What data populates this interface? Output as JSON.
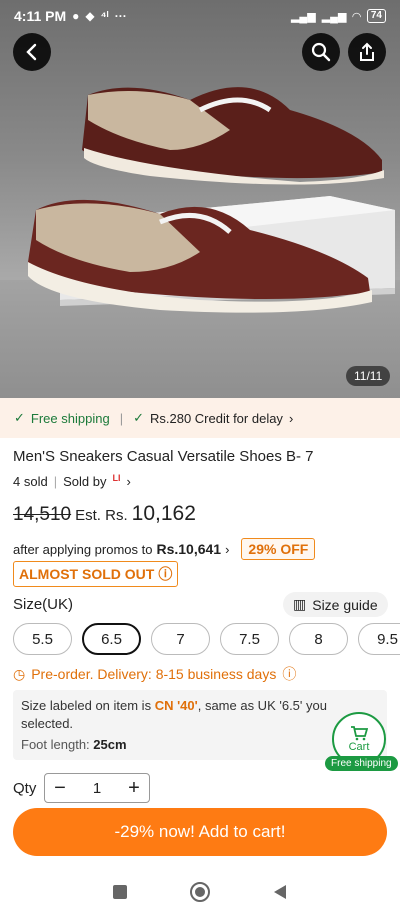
{
  "status_bar": {
    "time": "4:11 PM",
    "battery": "74"
  },
  "hero": {
    "counter": "11/11"
  },
  "shipping": {
    "free_shipping": "Free shipping",
    "credit": "Rs.280 Credit for delay"
  },
  "product": {
    "title": "Men'S Sneakers Casual Versatile Shoes B- 7",
    "sold_count": "4 sold",
    "sold_by": "Sold by",
    "seller_logo": "LI"
  },
  "price": {
    "original": "14,510",
    "est_label": "Est. Rs.",
    "current": "10,162",
    "promo_text": "after applying promos to",
    "promo_amount": "Rs.10,641",
    "discount_badge": "29% OFF",
    "stock_badge": "ALMOST SOLD OUT"
  },
  "size": {
    "label": "Size(UK)",
    "guide": "Size guide",
    "options": [
      "5.5",
      "6.5",
      "7",
      "7.5",
      "8",
      "9.5"
    ],
    "selected": "6.5"
  },
  "preorder": "Pre-order. Delivery: 8-15 business days",
  "size_info": {
    "text_pre": "Size labeled on item is ",
    "cn_value": "CN '40'",
    "text_post": ", same as UK '6.5' you selected.",
    "foot_label": "Foot length: ",
    "foot_value": "25cm"
  },
  "cart_badge": {
    "label": "Cart",
    "tag": "Free shipping"
  },
  "quantity": {
    "label": "Qty",
    "value": "1"
  },
  "cta": "-29% now! Add to cart!",
  "colors": {
    "accent": "#fe7b13",
    "green": "#1c9a42",
    "shipping_bg": "#fdf1e8"
  }
}
